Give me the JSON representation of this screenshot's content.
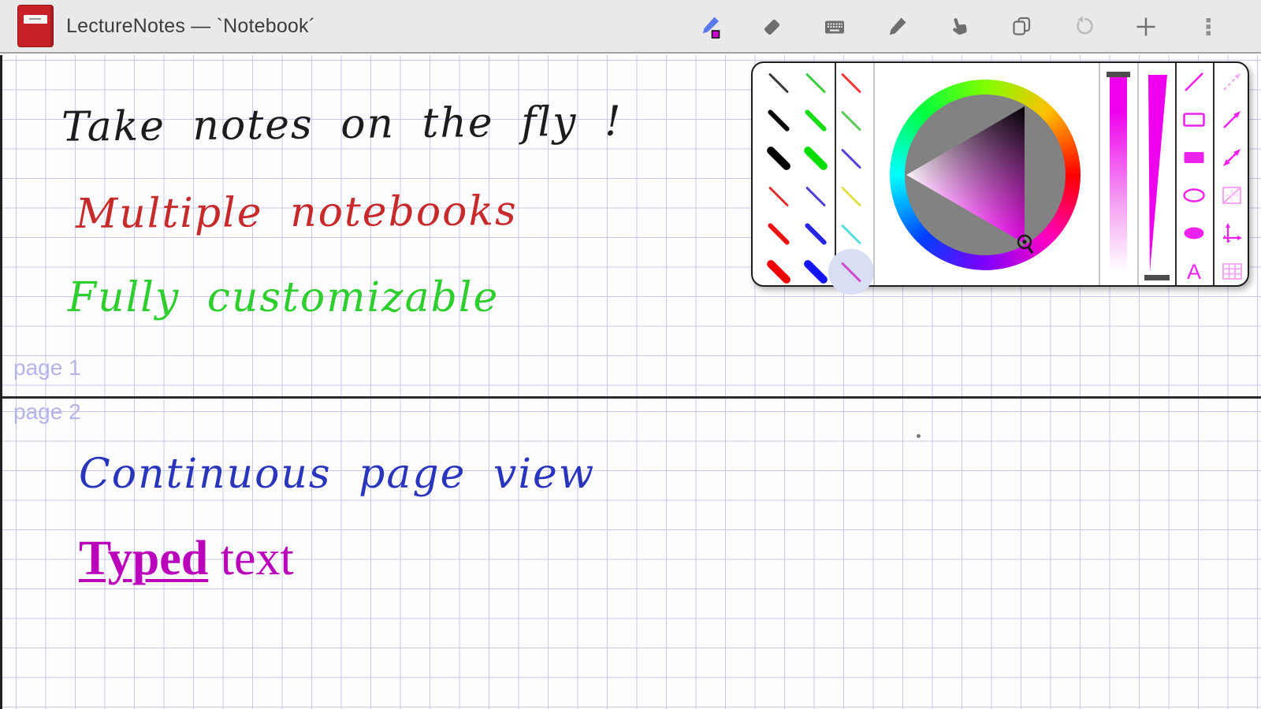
{
  "window": {
    "title": "LectureNotes — `Notebook´"
  },
  "toolbar": {
    "buttons": [
      {
        "name": "pen",
        "state": "active"
      },
      {
        "name": "eraser",
        "state": "normal"
      },
      {
        "name": "keyboard",
        "state": "normal"
      },
      {
        "name": "pencil",
        "state": "normal"
      },
      {
        "name": "finger",
        "state": "normal"
      },
      {
        "name": "duplicate-page",
        "state": "normal"
      },
      {
        "name": "undo",
        "state": "disabled"
      },
      {
        "name": "add",
        "state": "normal"
      },
      {
        "name": "overflow-menu",
        "state": "normal"
      }
    ],
    "pen_badge_color": "#cc00cc"
  },
  "popup": {
    "presets_col1": [
      {
        "color": "#3a3a3a",
        "size": "thin"
      },
      {
        "color": "#0a0a0a",
        "size": "medium"
      },
      {
        "color": "#000000",
        "size": "thick"
      },
      {
        "color": "#e03030",
        "size": "thin"
      },
      {
        "color": "#ee1111",
        "size": "medium"
      },
      {
        "color": "#ee0000",
        "size": "thick"
      }
    ],
    "presets_col2": [
      {
        "color": "#3ccc3c",
        "size": "thin"
      },
      {
        "color": "#17dd17",
        "size": "medium"
      },
      {
        "color": "#00dd00",
        "size": "thick"
      },
      {
        "color": "#4a42cc",
        "size": "thin"
      },
      {
        "color": "#2424e4",
        "size": "medium"
      },
      {
        "color": "#1414f4",
        "size": "thick"
      }
    ],
    "presets_col3": [
      {
        "color": "#ee3a3a",
        "size": "thin",
        "selected": false
      },
      {
        "color": "#58cc58",
        "size": "thin",
        "selected": false
      },
      {
        "color": "#5540d8",
        "size": "thin",
        "selected": false
      },
      {
        "color": "#dde14e",
        "size": "thin",
        "selected": false
      },
      {
        "color": "#55dddd",
        "size": "thin",
        "selected": false
      },
      {
        "color": "#cc4bcc",
        "size": "thin",
        "selected": true
      }
    ],
    "selected_hue_color": "#ee00ee",
    "highlight_color": "#d9def5",
    "shape_tools": [
      "line",
      "rectangle",
      "filled-rectangle",
      "ellipse",
      "filled-ellipse",
      "text"
    ],
    "text_tool_label": "A",
    "guide_tools": [
      "dashed-arrow",
      "arrow",
      "double-arrow",
      "crossed-rectangle",
      "coordinate-axes",
      "grid"
    ]
  },
  "canvas": {
    "grid_color": "#c9c9ee",
    "page_label_color": "#b4b4e8",
    "pages": [
      {
        "label": "page 1",
        "notes": [
          {
            "text": "Take notes on the fly !",
            "color": "#1c1c1c"
          },
          {
            "text": "Multiple notebooks",
            "color": "#c62a2a"
          },
          {
            "text": "Fully customizable",
            "color": "#2fce2f"
          }
        ]
      },
      {
        "label": "page 2",
        "notes": [
          {
            "text": "Continuous page view",
            "color": "#2a35bd"
          }
        ],
        "typed_note": {
          "bold": "Typed",
          "rest": " text",
          "color": "#ba00ba"
        }
      }
    ]
  }
}
